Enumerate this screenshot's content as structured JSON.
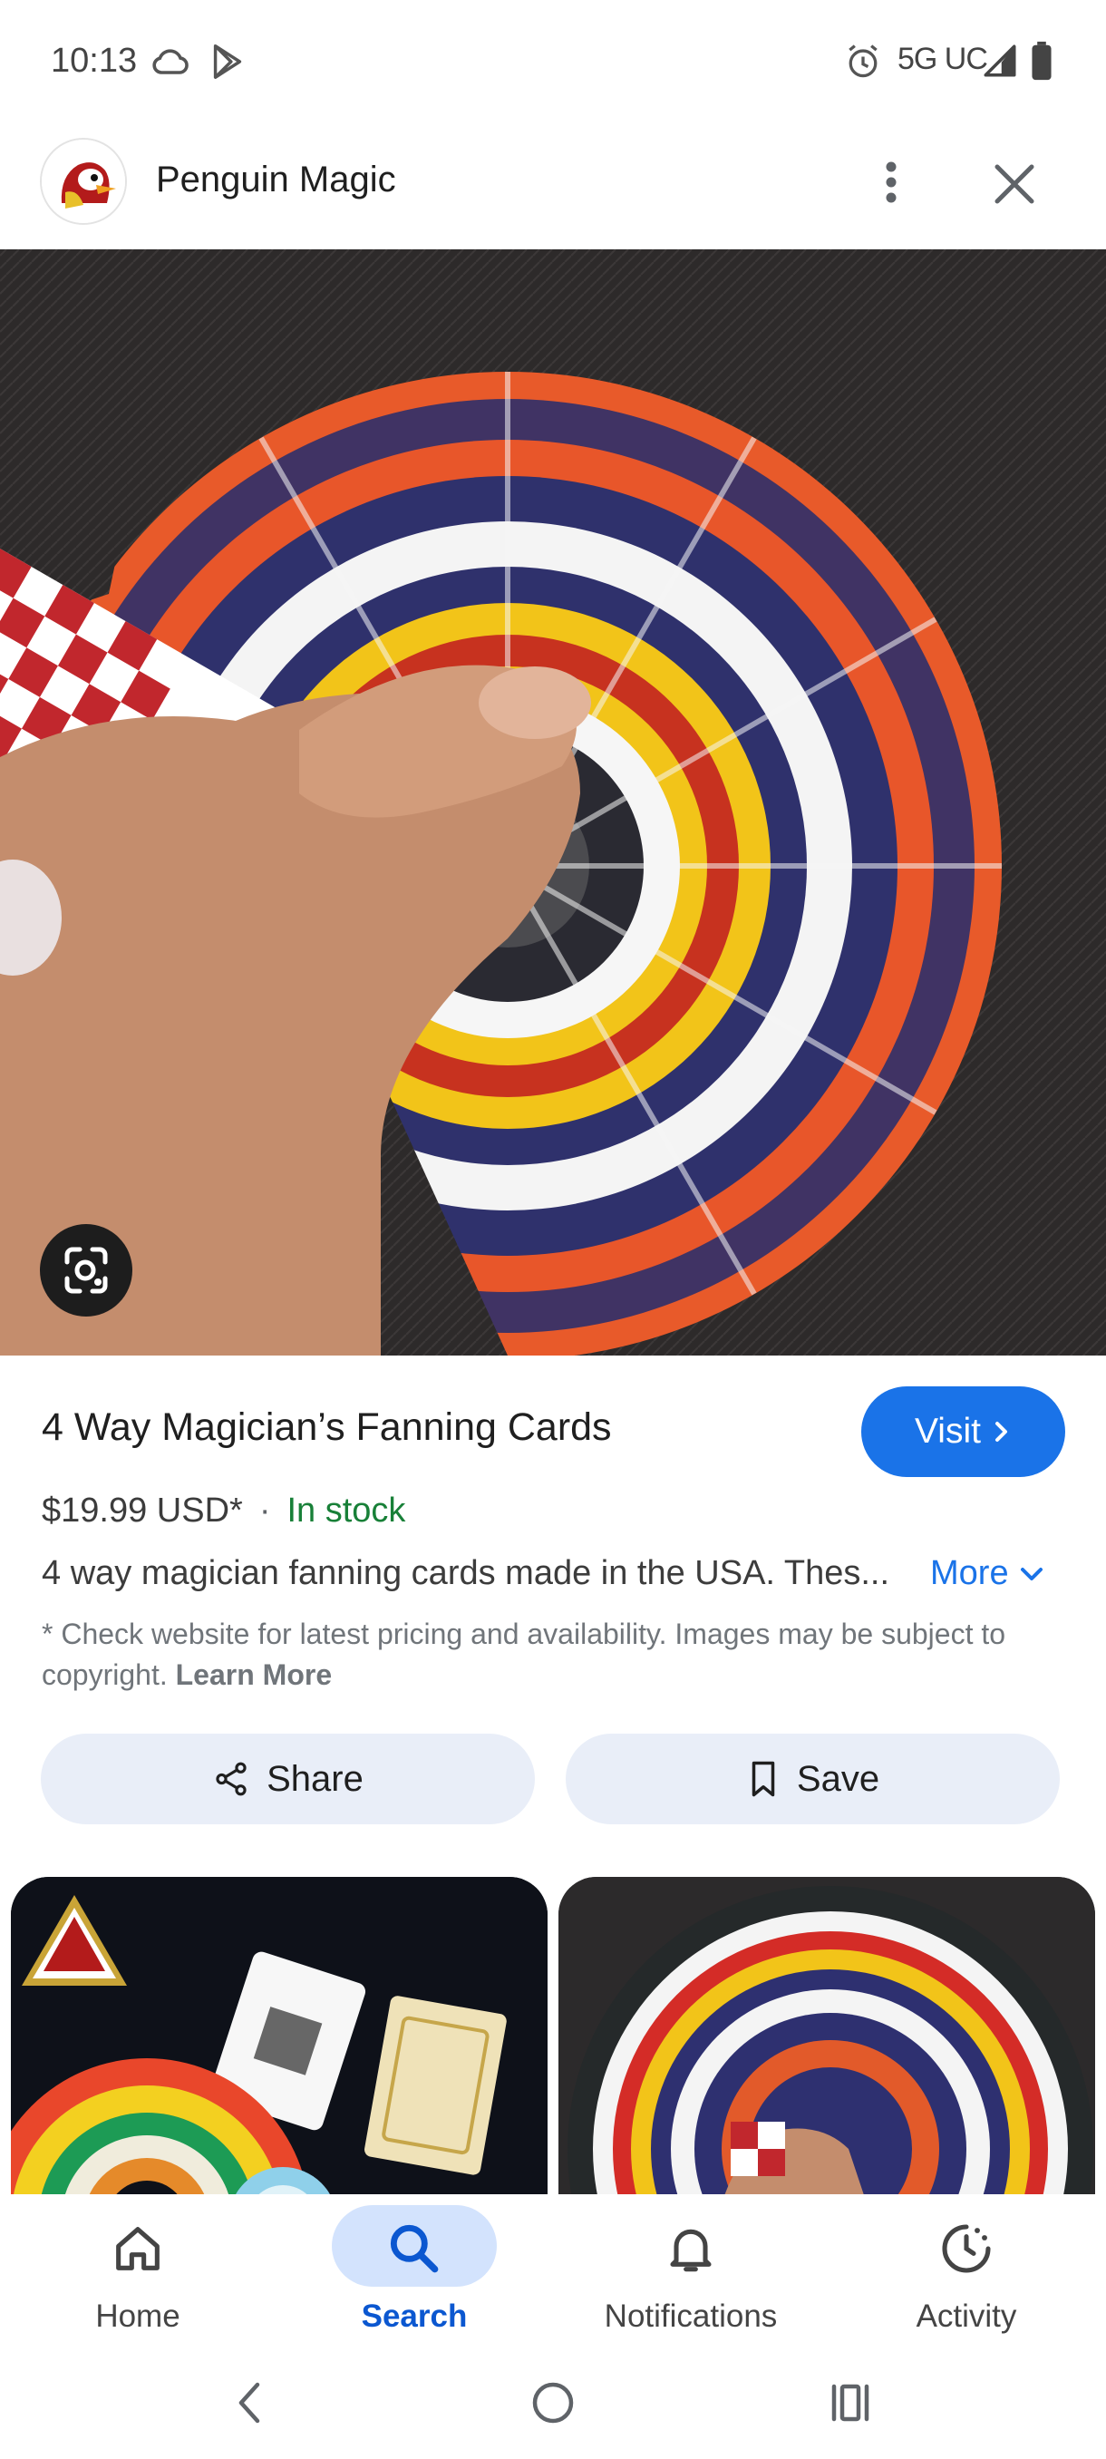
{
  "status_bar": {
    "time": "10:13",
    "network": "5G UC"
  },
  "header": {
    "site_name": "Penguin Magic"
  },
  "product": {
    "title": "4 Way Magician’s Fanning Cards",
    "visit_label": "Visit",
    "price": "$19.99 USD*",
    "separator": "·",
    "availability": "In stock",
    "description": "4 way magician fanning cards made in the USA. Thes...",
    "more_label": "More",
    "disclaimer": "* Check website for latest pricing and availability. Images may be subject to copyright.",
    "learn_more_label": "Learn More"
  },
  "actions": {
    "share_label": "Share",
    "save_label": "Save"
  },
  "bottom_nav": {
    "items": [
      {
        "label": "Home",
        "icon": "home-icon"
      },
      {
        "label": "Search",
        "icon": "search-icon",
        "active": true
      },
      {
        "label": "Notifications",
        "icon": "bell-icon"
      },
      {
        "label": "Activity",
        "icon": "activity-icon"
      }
    ]
  },
  "colors": {
    "accent": "#1a73e8",
    "in_stock": "#188038",
    "pill_bg": "#e9eef8",
    "active_nav_bg": "#d3e3fd"
  }
}
